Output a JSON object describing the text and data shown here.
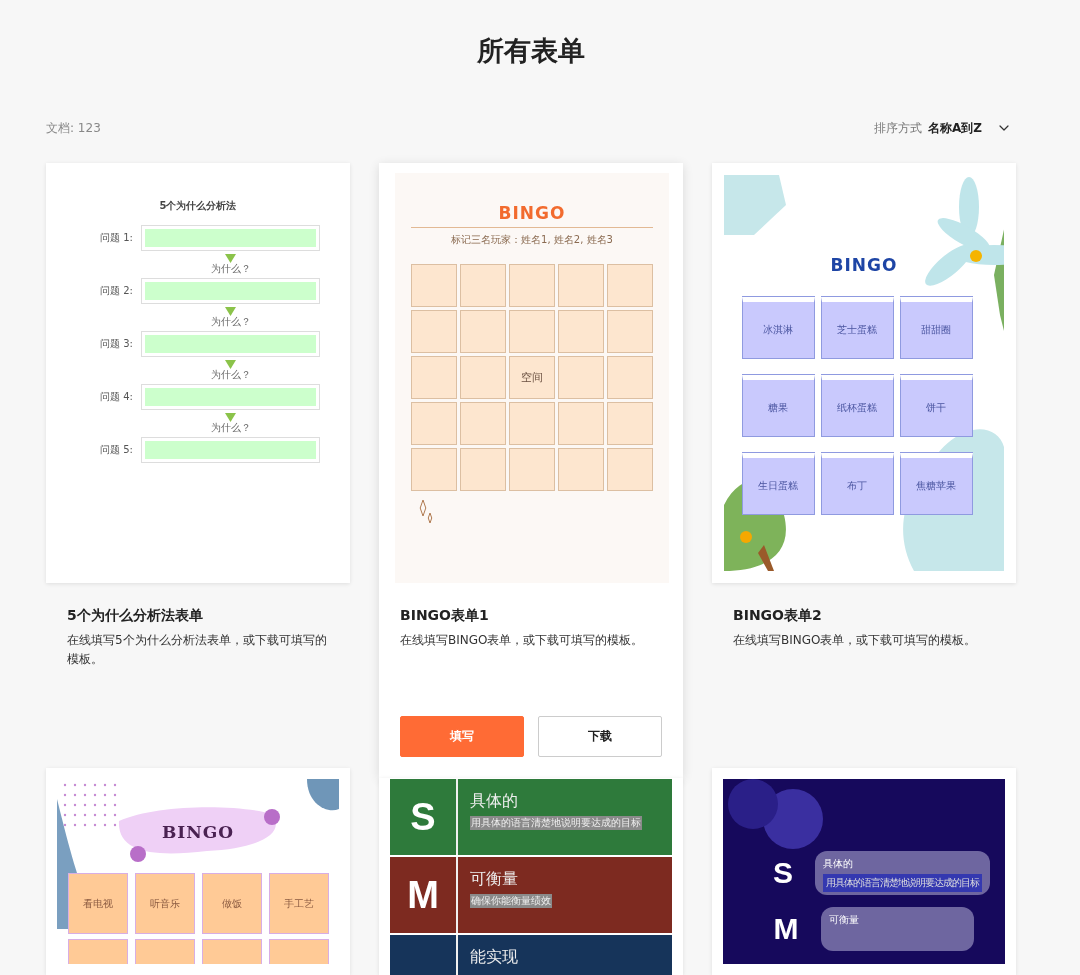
{
  "title": "所有表单",
  "toolbar": {
    "count": "文档: 123",
    "sort_label": "排序方式",
    "sort_value": "名称A到Z"
  },
  "forms": [
    {
      "kind": "why5",
      "hovered": false,
      "name": "5个为什么分析法表单",
      "description": "在线填写5个为什么分析法表单，或下载可填写的模板。",
      "preview": {
        "heading": "5个为什么分析法",
        "steps": [
          {
            "label": "问题 1:",
            "why": "为什么？"
          },
          {
            "label": "问题 2:",
            "why": "为什么？"
          },
          {
            "label": "问题 3:",
            "why": "为什么？"
          },
          {
            "label": "问题 4:",
            "why": "为什么？"
          },
          {
            "label": "问题 5:"
          }
        ]
      }
    },
    {
      "kind": "bingo_grid",
      "hovered": true,
      "name": "BINGO表单1",
      "description": "在线填写BINGO表单，或下载可填写的模板。",
      "preview": {
        "heading": "BINGO",
        "subtitle": "标记三名玩家：姓名1, 姓名2, 姓名3",
        "center": "空间"
      },
      "actions": [
        {
          "label": "填写",
          "kind": "primary"
        },
        {
          "label": "下载",
          "kind": "secondary"
        }
      ]
    },
    {
      "kind": "bingo_cards",
      "hovered": false,
      "name": "BINGO表单2",
      "description": "在线填写BINGO表单，或下载可填写的模板。",
      "preview": {
        "heading": "BINGO",
        "cells": [
          "冰淇淋",
          "芝士蛋糕",
          "甜甜圈",
          "糖果",
          "纸杯蛋糕",
          "饼干",
          "生日蛋糕",
          "布丁",
          "焦糖苹果"
        ]
      }
    },
    {
      "kind": "bingo_blob",
      "hovered": false,
      "preview": {
        "heading": "BINGO",
        "cells": [
          "看电视",
          "听音乐",
          "做饭",
          "手工艺"
        ]
      }
    },
    {
      "kind": "smart_table",
      "hovered": false,
      "preview": {
        "rows": [
          {
            "letter": "S",
            "title": "具体的",
            "text": "用具体的语言清楚地说明要达成的目标",
            "color": "#2e7a3b"
          },
          {
            "letter": "M",
            "title": "可衡量",
            "text": "确保你能衡量绩效",
            "color": "#7d2a20"
          },
          {
            "title": "能实现",
            "color": "#16345a"
          }
        ]
      }
    },
    {
      "kind": "smart_dark",
      "hovered": false,
      "preview": {
        "rows": [
          {
            "letter": "S",
            "title": "具体的",
            "text": "用具体的语言清楚地说明要达成的目标"
          },
          {
            "letter": "M",
            "title": "可衡量"
          }
        ]
      }
    }
  ]
}
